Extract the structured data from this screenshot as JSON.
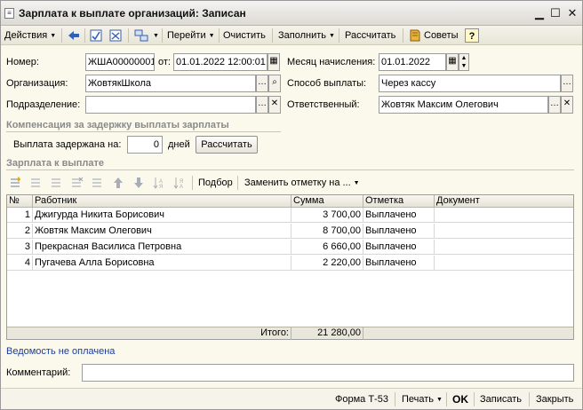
{
  "window": {
    "title": "Зарплата к выплате организаций: Записан"
  },
  "toolbar": {
    "actions": "Действия",
    "goto": "Перейти",
    "clear": "Очистить",
    "fill": "Заполнить",
    "calc": "Рассчитать",
    "tips": "Советы",
    "help": "?"
  },
  "form": {
    "number_label": "Номер:",
    "number_value": "ЖША00000001",
    "from_label": "от:",
    "date_value": "01.01.2022 12:00:01",
    "month_label": "Месяц начисления:",
    "month_value": "01.01.2022",
    "org_label": "Организация:",
    "org_value": "ЖовтякШкола",
    "pay_label": "Способ выплаты:",
    "pay_value": "Через кассу",
    "dept_label": "Подразделение:",
    "dept_value": "",
    "resp_label": "Ответственный:",
    "resp_value": "Жовтяк Максим Олегович"
  },
  "compensation": {
    "section_title": "Компенсация за задержку выплаты зарплаты",
    "delay_label": "Выплата задержана на:",
    "delay_value": "0",
    "days_label": "дней",
    "calc_button": "Рассчитать"
  },
  "salary": {
    "section_title": "Зарплата к выплате",
    "selection": "Подбор",
    "replace_mark": "Заменить отметку на ...",
    "columns": {
      "n": "№",
      "worker": "Работник",
      "sum": "Сумма",
      "mark": "Отметка",
      "doc": "Документ"
    },
    "rows": [
      {
        "n": "1",
        "worker": "Джигурда Никита Борисович",
        "sum": "3 700,00",
        "mark": "Выплачено",
        "doc": ""
      },
      {
        "n": "2",
        "worker": "Жовтяк Максим Олегович",
        "sum": "8 700,00",
        "mark": "Выплачено",
        "doc": ""
      },
      {
        "n": "3",
        "worker": "Прекрасная Василиса Петровна",
        "sum": "6 660,00",
        "mark": "Выплачено",
        "doc": ""
      },
      {
        "n": "4",
        "worker": "Пугачева Алла Борисовна",
        "sum": "2 220,00",
        "mark": "Выплачено",
        "doc": ""
      }
    ],
    "total_label": "Итого:",
    "total_value": "21 280,00"
  },
  "status_link": "Ведомость не оплачена",
  "comment": {
    "label": "Комментарий:",
    "value": ""
  },
  "bottom": {
    "form_t53": "Форма Т-53",
    "print": "Печать",
    "ok": "OK",
    "save": "Записать",
    "close": "Закрыть"
  },
  "colors": {
    "background": "#fbf9ec",
    "link": "#1b3d9a",
    "section": "#8a8a8a"
  }
}
